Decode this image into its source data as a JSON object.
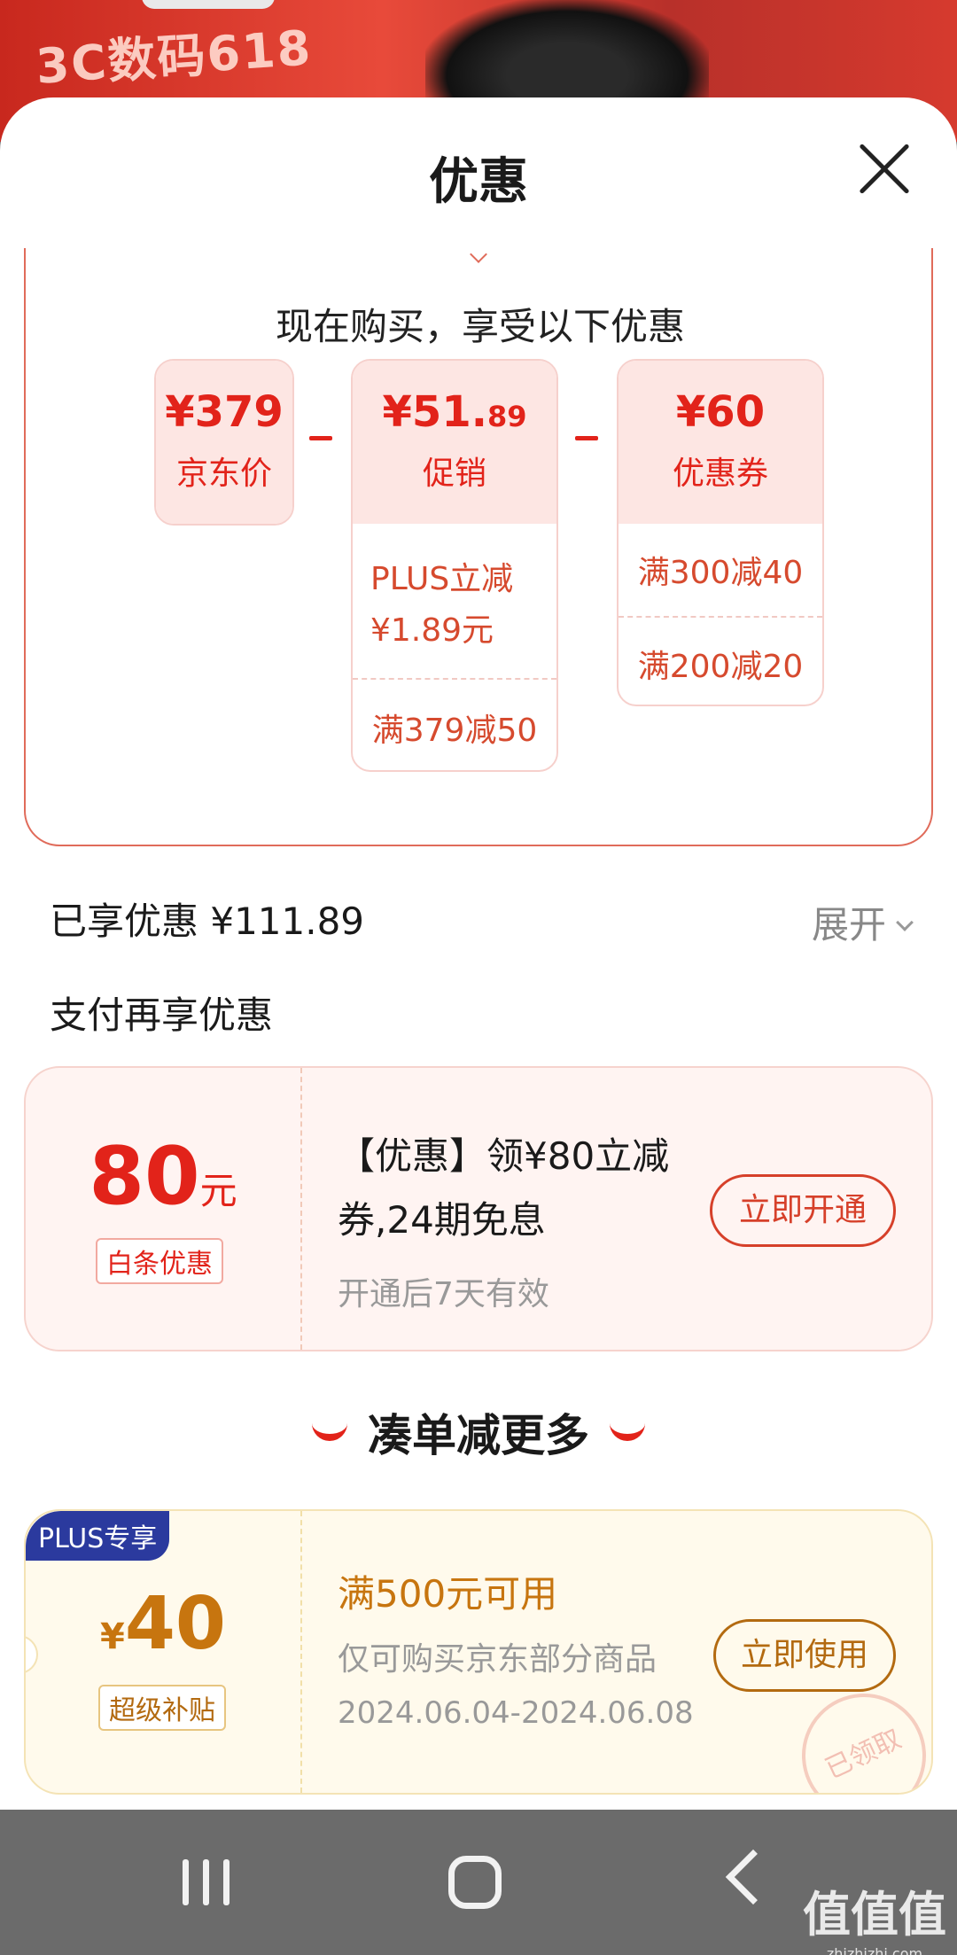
{
  "banner": {
    "text": "3C数码618"
  },
  "sheet": {
    "title": "优惠"
  },
  "breakdown": {
    "heading": "现在购买，享受以下优惠",
    "jd_price": {
      "amount": "¥379",
      "label": "京东价"
    },
    "promo": {
      "amount_main": "¥51.",
      "amount_decimal": "89",
      "label": "促销",
      "items": [
        "PLUS立减",
        "¥1.89元",
        "满379减50"
      ]
    },
    "coupon": {
      "amount": "¥60",
      "label": "优惠券",
      "items": [
        "满300减40",
        "满200减20"
      ]
    }
  },
  "enjoyed": {
    "text": "已享优惠 ¥111.89",
    "expand_label": "展开"
  },
  "pay_section": {
    "title": "支付再享优惠"
  },
  "pay_coupon": {
    "amount": "80",
    "unit": "元",
    "tag": "白条优惠",
    "title": "【优惠】领¥80立减券,24期免息",
    "subtitle": "开通后7天有效",
    "button": "立即开通"
  },
  "more": {
    "title": "凑单减更多"
  },
  "plus_coupon": {
    "badge": "PLUS专享",
    "currency": "¥",
    "amount": "40",
    "tag": "超级补贴",
    "title": "满500元可用",
    "subtitle": "仅可购买京东部分商品",
    "date": "2024.06.04-2024.06.08",
    "button": "立即使用",
    "stamp": "已领取"
  },
  "watermark": {
    "text": "值值值",
    "sub": "zhizhizhi.com"
  },
  "icons": {
    "close": "close-icon",
    "expand": "chevron-down-icon",
    "nav_recent": "recent-apps-icon",
    "nav_home": "home-icon",
    "nav_back": "back-icon"
  },
  "colors": {
    "accent_red": "#e2231a",
    "gold": "#c7750f",
    "plus_blue": "#2b3a9e"
  }
}
